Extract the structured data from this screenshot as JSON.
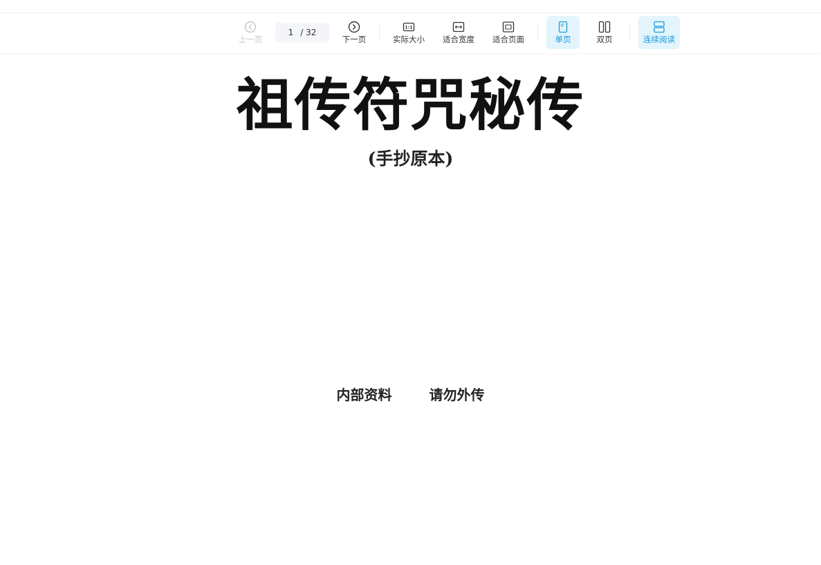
{
  "toolbar": {
    "prev_label": "上一页",
    "next_label": "下一页",
    "page_current": "1",
    "page_total": "/ 32",
    "actual_size_label": "实际大小",
    "fit_width_label": "适合宽度",
    "fit_page_label": "适合页面",
    "single_page_label": "单页",
    "double_page_label": "双页",
    "continuous_label": "连续阅读",
    "actual_size_icon_text": "1:1"
  },
  "document": {
    "title": "祖传符咒秘传",
    "subtitle": "(手抄原本)",
    "footer_left": "内部资料",
    "footer_right": "请勿外传"
  },
  "colors": {
    "accent": "#1c9ad6",
    "active_bg": "#e3f4fd",
    "disabled": "#c2c6cc"
  }
}
